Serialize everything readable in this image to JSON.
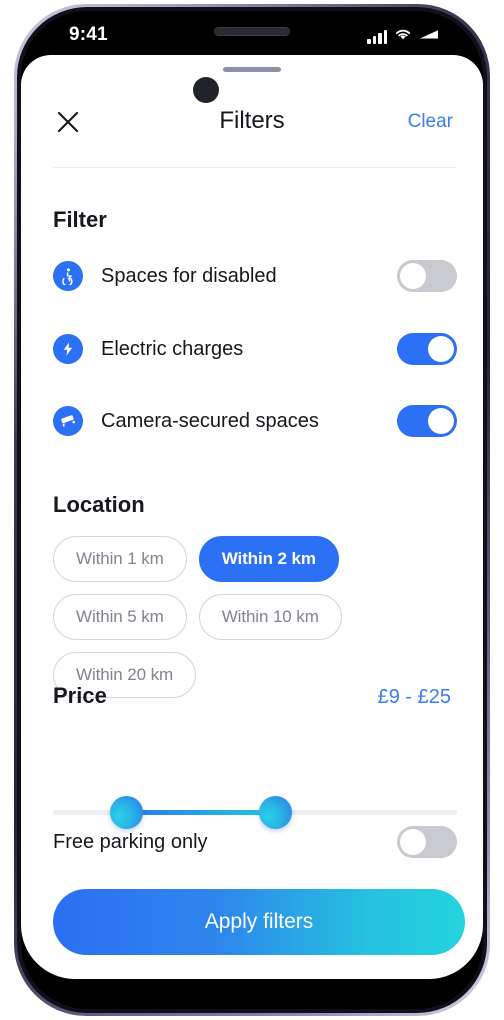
{
  "status_bar": {
    "time": "9:41",
    "icons": [
      "signal-icon",
      "wifi-icon",
      "battery-icon"
    ]
  },
  "header": {
    "close_icon": "close-icon",
    "title": "Filters",
    "clear_label": "Clear"
  },
  "filter_section": {
    "title": "Filter",
    "rows": [
      {
        "icon": "wheelchair-icon",
        "label": "Spaces for disabled",
        "enabled": false
      },
      {
        "icon": "lightning-bolt-icon",
        "label": "Electric charges",
        "enabled": true
      },
      {
        "icon": "cctv-camera-icon",
        "label": "Camera-secured spaces",
        "enabled": true
      }
    ]
  },
  "location_section": {
    "title": "Location",
    "chips": [
      {
        "label": "Within 1 km",
        "selected": false
      },
      {
        "label": "Within 2 km",
        "selected": true
      },
      {
        "label": "Within 5 km",
        "selected": false
      },
      {
        "label": "Within 10 km",
        "selected": false
      },
      {
        "label": "Within 20 km",
        "selected": false
      }
    ]
  },
  "price_section": {
    "title": "Price",
    "range_label": "£9 - £25",
    "min_value": 9,
    "max_value": 25,
    "free_parking_label": "Free parking only",
    "free_parking_enabled": false
  },
  "footer": {
    "apply_label": "Apply filters"
  },
  "colors": {
    "accent_blue": "#2b70f5",
    "link_blue": "#3b7cf0",
    "toggle_off": "#c9cacf",
    "cta_gradient_start": "#2b6ff2",
    "cta_gradient_end": "#24d4dd",
    "text_primary": "#16181d",
    "chip_text": "#80848e"
  }
}
